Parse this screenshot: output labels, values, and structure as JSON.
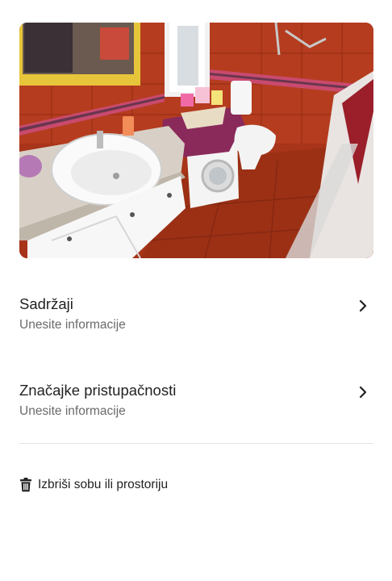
{
  "room_photo": {
    "icon": "bathroom-photo"
  },
  "amenities": {
    "title": "Sadržaji",
    "subtitle": "Unesite informacije",
    "icon": "chevron-right-icon"
  },
  "accessibility": {
    "title": "Značajke pristupačnosti",
    "subtitle": "Unesite informacije",
    "icon": "chevron-right-icon"
  },
  "delete_action": {
    "label": "Izbriši sobu ili prostoriju",
    "icon": "trash-icon"
  }
}
